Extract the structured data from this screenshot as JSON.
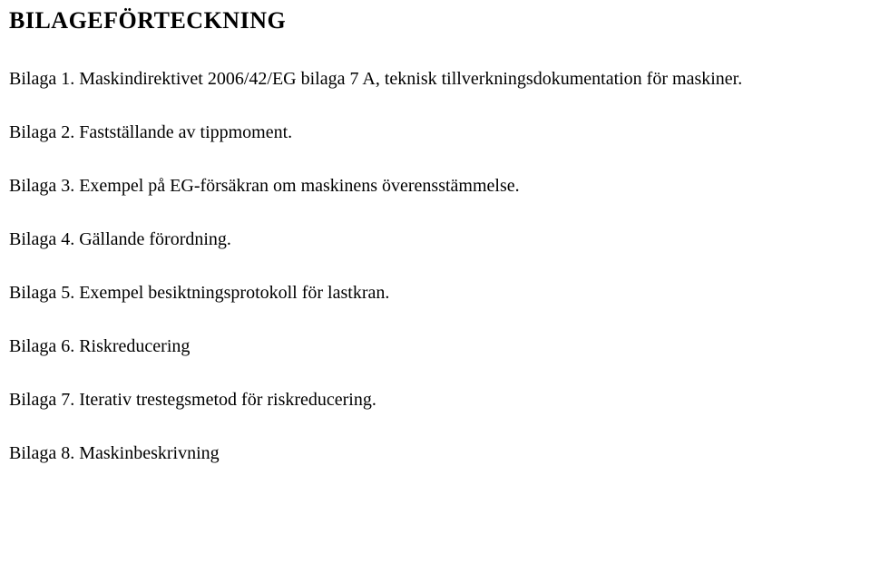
{
  "heading": "BILAGEFÖRTECKNING",
  "entries": [
    "Bilaga 1. Maskindirektivet 2006/42/EG bilaga 7 A, teknisk tillverkningsdokumentation för maskiner.",
    "Bilaga 2. Fastställande av tippmoment.",
    "Bilaga 3. Exempel på EG-försäkran om maskinens överensstämmelse.",
    "Bilaga 4. Gällande förordning.",
    "Bilaga 5. Exempel besiktningsprotokoll för lastkran.",
    "Bilaga 6. Riskreducering",
    "Bilaga 7. Iterativ trestegsmetod för riskreducering.",
    "Bilaga 8. Maskinbeskrivning"
  ]
}
